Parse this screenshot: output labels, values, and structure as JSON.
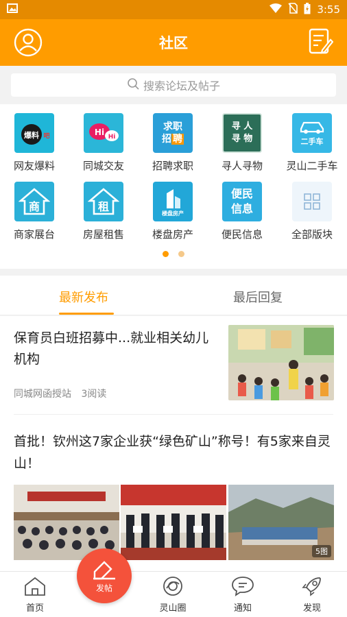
{
  "status_bar": {
    "time": "3:55"
  },
  "header": {
    "title": "社区"
  },
  "search": {
    "placeholder": "搜索论坛及帖子"
  },
  "categories": [
    {
      "label": "网友爆料",
      "icon": "baoliao-icon",
      "tile_text": "爆料",
      "color": "#1fb6d8"
    },
    {
      "label": "同城交友",
      "icon": "hi-chat-icon",
      "tile_text": "Hi",
      "color": "#2bb6d8"
    },
    {
      "label": "招聘求职",
      "icon": "recruit-icon",
      "tile_text": "求职招聘",
      "color": "#2a9fd8"
    },
    {
      "label": "寻人寻物",
      "icon": "search-person-icon",
      "tile_text": "寻人寻物",
      "color": "#2c6e58"
    },
    {
      "label": "灵山二手车",
      "icon": "car-icon",
      "tile_text": "二手车",
      "color": "#36b8e6"
    },
    {
      "label": "商家展台",
      "icon": "shop-house-icon",
      "tile_text": "商",
      "color": "#2bb0d8"
    },
    {
      "label": "房屋租售",
      "icon": "rent-house-icon",
      "tile_text": "租",
      "color": "#2bb0d8"
    },
    {
      "label": "楼盘房产",
      "icon": "building-icon",
      "tile_text": "楼盘房产",
      "color": "#22a7d8"
    },
    {
      "label": "便民信息",
      "icon": "info-icon",
      "tile_text": "便民信息",
      "color": "#2eaee0"
    },
    {
      "label": "全部版块",
      "icon": "grid-icon",
      "tile_text": "",
      "color": "#eef5fb"
    }
  ],
  "tabs": [
    {
      "label": "最新发布",
      "active": true
    },
    {
      "label": "最后回复",
      "active": false
    }
  ],
  "posts": [
    {
      "title": "保育员白班招募中...就业相关幼儿机构",
      "source": "同城网函授站",
      "reads": "3阅读"
    },
    {
      "title": "首批！钦州这7家企业获“绿色矿山”称号！有5家来自灵山！",
      "image_count": "5图"
    }
  ],
  "bottom_nav": {
    "home": "首页",
    "post": "发帖",
    "circle": "灵山圈",
    "notify": "通知",
    "discover": "发现"
  },
  "colors": {
    "brand": "#ff9c00",
    "fab": "#f4523b"
  }
}
